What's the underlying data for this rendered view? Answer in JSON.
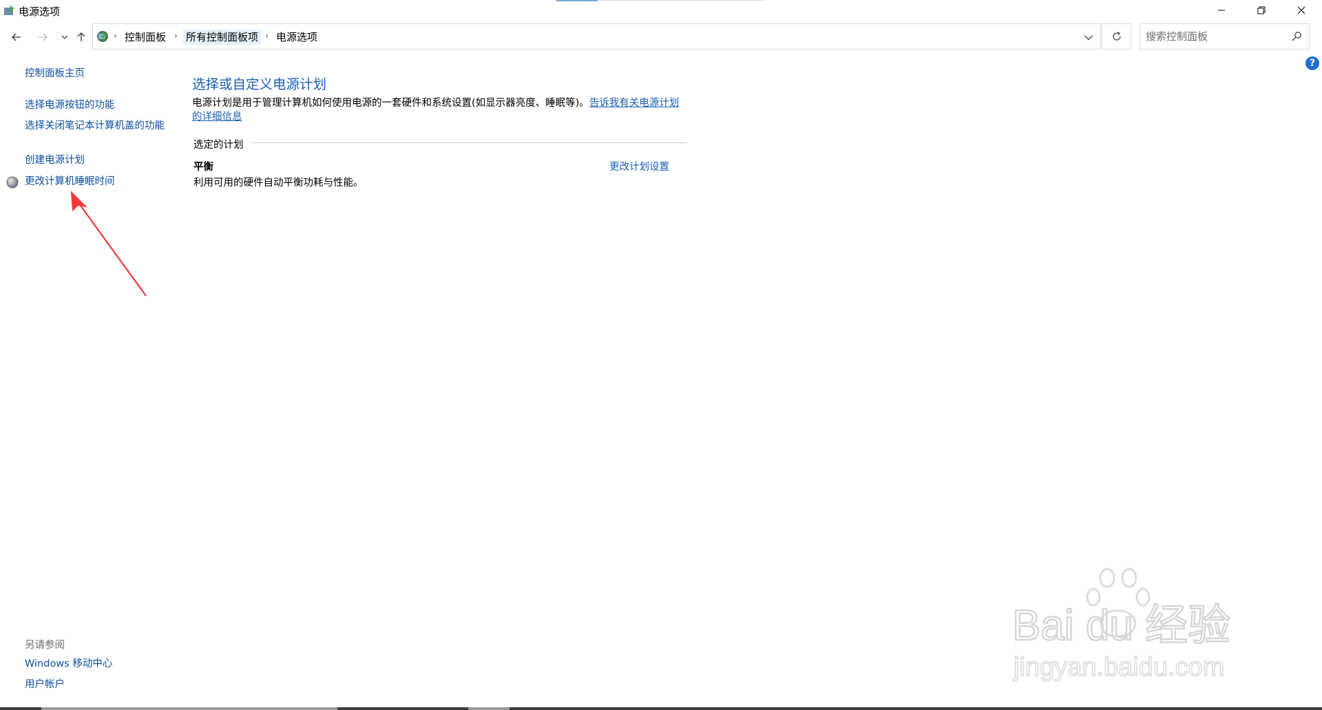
{
  "window": {
    "title": "电源选项",
    "controls": {
      "minimize": "minimize-icon",
      "restore": "restore-icon",
      "close": "close-icon"
    }
  },
  "navigation": {
    "breadcrumbs": [
      {
        "label": "控制面板"
      },
      {
        "label": "所有控制面板项"
      },
      {
        "label": "电源选项"
      }
    ],
    "search_placeholder": "搜索控制面板"
  },
  "sidebar": {
    "home": "控制面板主页",
    "links": [
      {
        "label": "选择电源按钮的功能"
      },
      {
        "label": "选择关闭笔记本计算机盖的功能"
      },
      {
        "label": "创建电源计划"
      },
      {
        "label": "更改计算机睡眠时间"
      }
    ],
    "see_also_label": "另请参阅",
    "see_also": [
      {
        "label": "Windows 移动中心"
      },
      {
        "label": "用户帐户"
      }
    ]
  },
  "main": {
    "title": "选择或自定义电源计划",
    "description": "电源计划是用于管理计算机如何使用电源的一套硬件和系统设置(如显示器亮度、睡眠等)。",
    "description_link": "告诉我有关电源计划的详细信息",
    "selected_group_label": "选定的计划",
    "plan": {
      "name": "平衡",
      "description": "利用可用的硬件自动平衡功耗与性能。",
      "change_link": "更改计划设置"
    }
  },
  "watermark": {
    "brand": "Bai du 经验",
    "url": "jingyan.baidu.com"
  },
  "colors": {
    "link": "#0c4f9e",
    "title": "#1a5fb4",
    "arrow": "#f03a3a"
  }
}
